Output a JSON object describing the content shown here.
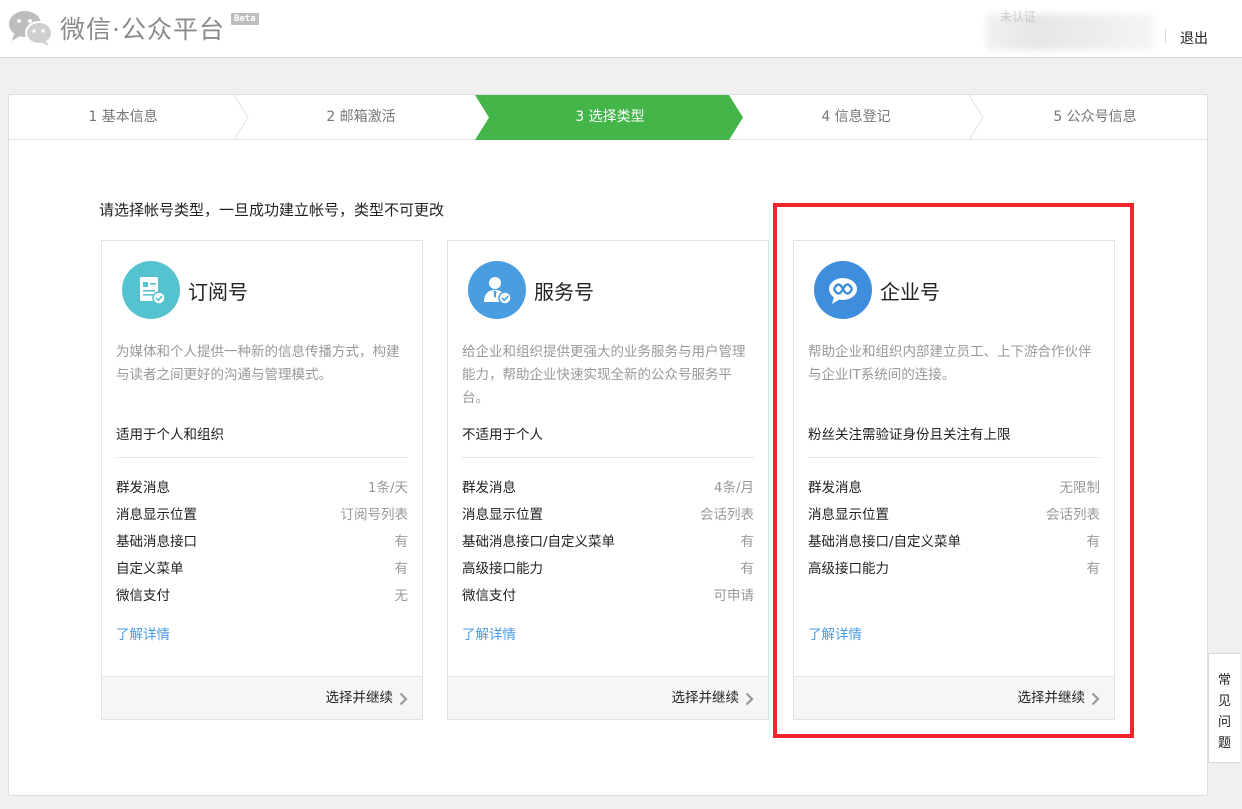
{
  "header": {
    "logo_text": "微信·公众平台",
    "beta_label": "Beta",
    "unverified_label": "未认证",
    "logout_label": "退出"
  },
  "steps": [
    {
      "label": "1 基本信息",
      "state": "done"
    },
    {
      "label": "2 邮箱激活",
      "state": "done"
    },
    {
      "label": "3 选择类型",
      "state": "active"
    },
    {
      "label": "4 信息登记",
      "state": "todo"
    },
    {
      "label": "5 公众号信息",
      "state": "todo"
    }
  ],
  "prompt": "请选择帐号类型，一旦成功建立帐号，类型不可更改",
  "cards": [
    {
      "title": "订阅号",
      "icon": "document-icon",
      "icon_color": "#55c3cf",
      "desc": "为媒体和个人提供一种新的信息传播方式，构建与读者之间更好的沟通与管理模式。",
      "scope": "适用于个人和组织",
      "features": [
        {
          "name": "群发消息",
          "value": "1条/天"
        },
        {
          "name": "消息显示位置",
          "value": "订阅号列表"
        },
        {
          "name": "基础消息接口",
          "value": "有"
        },
        {
          "name": "自定义菜单",
          "value": "有"
        },
        {
          "name": "微信支付",
          "value": "无"
        }
      ],
      "more_label": "了解详情",
      "continue_label": "选择并继续"
    },
    {
      "title": "服务号",
      "icon": "user-service-icon",
      "icon_color": "#4a9ee0",
      "desc": "给企业和组织提供更强大的业务服务与用户管理能力，帮助企业快速实现全新的公众号服务平台。",
      "scope": "不适用于个人",
      "features": [
        {
          "name": "群发消息",
          "value": "4条/月"
        },
        {
          "name": "消息显示位置",
          "value": "会话列表"
        },
        {
          "name": "基础消息接口/自定义菜单",
          "value": "有"
        },
        {
          "name": "高级接口能力",
          "value": "有"
        },
        {
          "name": "微信支付",
          "value": "可申请"
        }
      ],
      "more_label": "了解详情",
      "continue_label": "选择并继续"
    },
    {
      "title": "企业号",
      "icon": "enterprise-chat-icon",
      "icon_color": "#3f8ede",
      "desc": "帮助企业和组织内部建立员工、上下游合作伙伴与企业IT系统间的连接。",
      "scope": "粉丝关注需验证身份且关注有上限",
      "features": [
        {
          "name": "群发消息",
          "value": "无限制"
        },
        {
          "name": "消息显示位置",
          "value": "会话列表"
        },
        {
          "name": "基础消息接口/自定义菜单",
          "value": "有"
        },
        {
          "name": "高级接口能力",
          "value": "有"
        }
      ],
      "more_label": "了解详情",
      "continue_label": "选择并继续"
    }
  ],
  "faq": {
    "chars": [
      "常",
      "见",
      "问",
      "题"
    ]
  },
  "colors": {
    "active_step": "#44b549",
    "highlight": "#f1262c",
    "link": "#459ae9"
  }
}
